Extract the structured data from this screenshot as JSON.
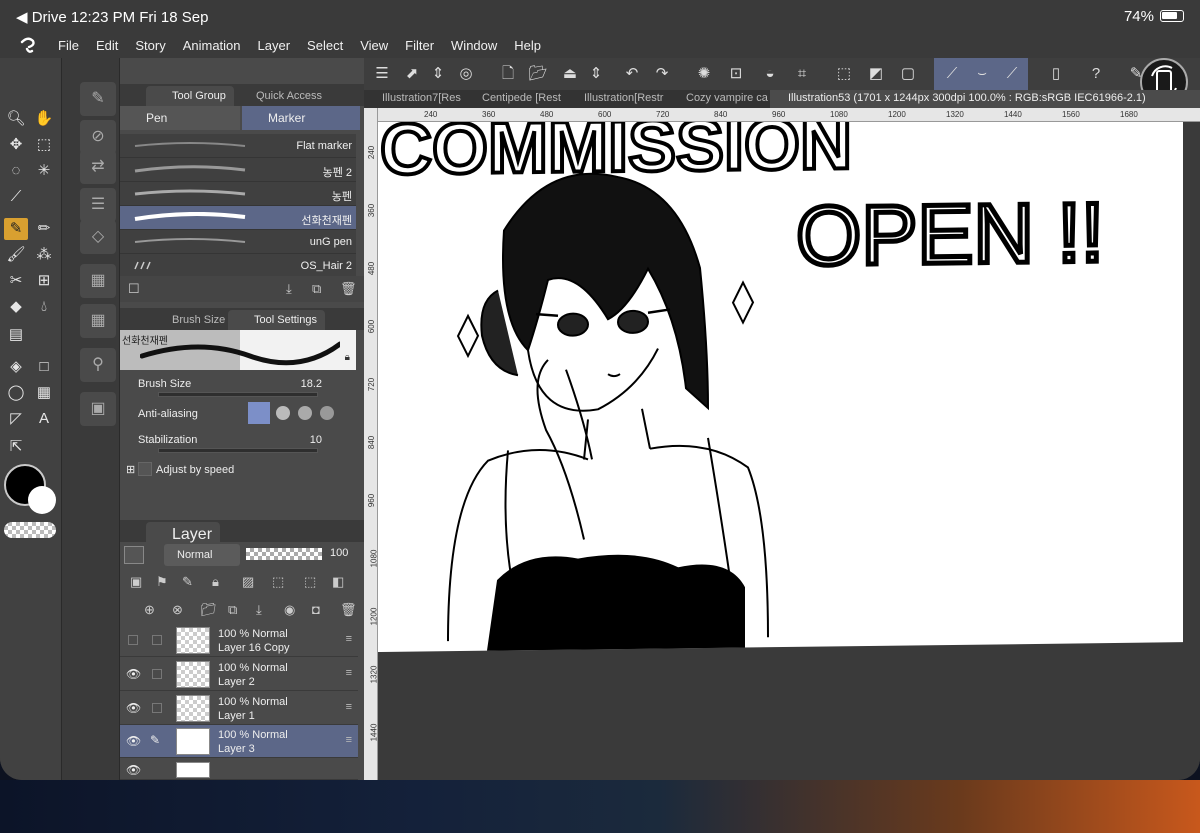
{
  "status": {
    "left": "◀ Drive  12:23 PM   Fri 18 Sep",
    "right": "74%"
  },
  "menu": [
    "File",
    "Edit",
    "Story",
    "Animation",
    "Layer",
    "Select",
    "View",
    "Filter",
    "Window",
    "Help"
  ],
  "toolgroup": {
    "tab1": "Tool Group",
    "tab2": "Quick Access",
    "sub1": "Pen",
    "sub2": "Marker"
  },
  "brushes": [
    "Flat marker",
    "농펜 2",
    "농펜",
    "선화천재펜",
    "unG pen",
    "OS_Hair 2"
  ],
  "toolsettings": {
    "tab1": "Brush Size",
    "tab2": "Tool Settings",
    "preview": "선화천재펜",
    "brush_size_label": "Brush Size",
    "brush_size": "18.2",
    "aa_label": "Anti-aliasing",
    "stab_label": "Stabilization",
    "stab": "10",
    "adjust": "Adjust by speed"
  },
  "layers": {
    "tab": "Layer",
    "blend": "Normal",
    "opacity": "100",
    "rows": [
      {
        "a": "100 %  Normal",
        "b": "Layer 16 Copy"
      },
      {
        "a": "100 %  Normal",
        "b": "Layer 2"
      },
      {
        "a": "100 %  Normal",
        "b": "Layer 1"
      },
      {
        "a": "100 %  Normal",
        "b": "Layer 3"
      }
    ]
  },
  "tabs": [
    "Illustration7[Res",
    "Centipede [Rest",
    "Illustration[Restr",
    "Cozy vampire ca",
    "Illustration53 (1701 x 1244px 300dpi 100.0% : RGB:sRGB IEC61966-2.1)"
  ],
  "ruler_top": [
    "240",
    "360",
    "480",
    "600",
    "720",
    "840",
    "960",
    "1080",
    "1200",
    "1320",
    "1440",
    "1560",
    "1680"
  ],
  "ruler_left": [
    "240",
    "360",
    "480",
    "600",
    "720",
    "840",
    "960",
    "1080",
    "1200",
    "1320",
    "1440"
  ],
  "artwork": {
    "headline": "COMMISSION",
    "subline": "OPEN !!"
  }
}
